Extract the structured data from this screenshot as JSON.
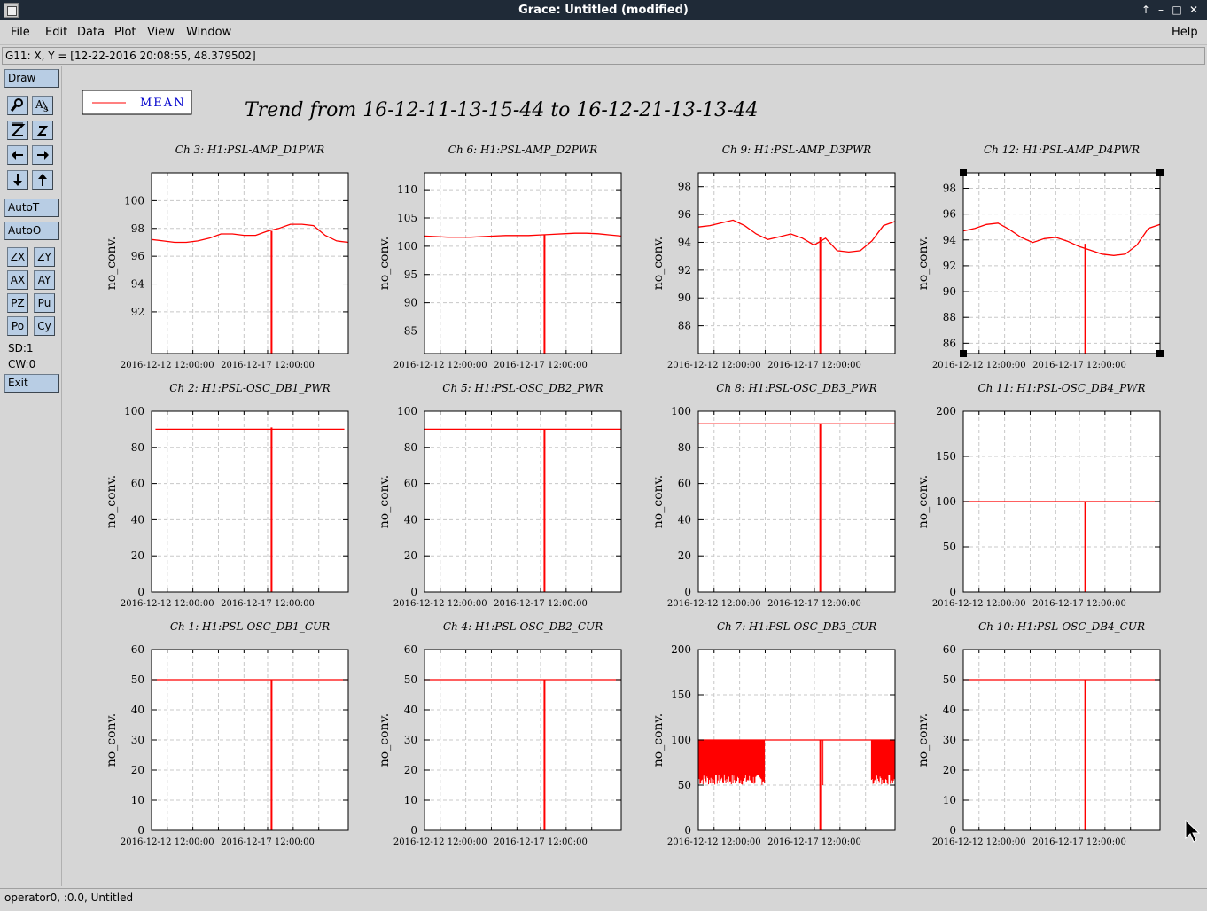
{
  "window": {
    "title": "Grace: Untitled (modified)",
    "buttons": [
      "↑",
      "–",
      "□",
      "✕"
    ]
  },
  "menubar": {
    "items": [
      "File",
      "Edit",
      "Data",
      "Plot",
      "View",
      "Window"
    ],
    "help": "Help"
  },
  "coords_readout": "G11: X, Y = [12-22-2016 20:08:55, 48.379502]",
  "toolbar": {
    "draw": "Draw",
    "autot": "AutoT",
    "autoo": "AutoO",
    "zx": "ZX",
    "zy": "ZY",
    "ax": "AX",
    "ay": "AY",
    "pz": "PZ",
    "pu": "Pu",
    "po": "Po",
    "cy": "Cy",
    "sd": "SD:1",
    "cw": "CW:0",
    "exit": "Exit"
  },
  "status": "operator0, :0.0, Untitled",
  "legend": {
    "label": "MEAN",
    "color": "#ff0000"
  },
  "main_title": "Trend from 16-12-11-13-15-44 to 16-12-21-13-13-44",
  "x_tick_labels": [
    "2016-12-12 12:00:00",
    "2016-12-17 12:00:00"
  ],
  "line_color": "#ff0000",
  "chart_data": [
    {
      "type": "line",
      "title": "Ch 3: H1:PSL-AMP_D1PWR",
      "ylabel": "no_conv.",
      "ylim": [
        89,
        102
      ],
      "yticks": [
        92,
        94,
        96,
        98,
        100
      ],
      "kind": "wave",
      "values": [
        97.2,
        97.1,
        97.0,
        97.0,
        97.1,
        97.3,
        97.6,
        97.6,
        97.5,
        97.5,
        97.8,
        98.0,
        98.3,
        98.3,
        98.2,
        97.5,
        97.1,
        97.0
      ],
      "spike_x": 0.61,
      "spike_top": 97.8
    },
    {
      "type": "line",
      "title": "Ch 6: H1:PSL-AMP_D2PWR",
      "ylabel": "no_conv.",
      "ylim": [
        81,
        113
      ],
      "yticks": [
        85,
        90,
        95,
        100,
        105,
        110
      ],
      "kind": "wave",
      "values": [
        101.8,
        101.7,
        101.6,
        101.6,
        101.6,
        101.7,
        101.8,
        101.9,
        101.9,
        101.9,
        102.0,
        102.1,
        102.2,
        102.3,
        102.3,
        102.2,
        102.0,
        101.8
      ],
      "spike_x": 0.61,
      "spike_top": 102.0
    },
    {
      "type": "line",
      "title": "Ch 9: H1:PSL-AMP_D3PWR",
      "ylabel": "no_conv.",
      "ylim": [
        86,
        99
      ],
      "yticks": [
        88,
        90,
        92,
        94,
        96,
        98
      ],
      "kind": "wave",
      "values": [
        95.1,
        95.2,
        95.4,
        95.6,
        95.2,
        94.6,
        94.2,
        94.4,
        94.6,
        94.3,
        93.8,
        94.3,
        93.4,
        93.3,
        93.4,
        94.1,
        95.2,
        95.5
      ],
      "spike_x": 0.62,
      "spike_top": 94.4
    },
    {
      "type": "line",
      "title": "Ch 12: H1:PSL-AMP_D4PWR",
      "ylabel": "no_conv.",
      "ylim": [
        85.2,
        99.2
      ],
      "yticks": [
        86,
        88,
        90,
        92,
        94,
        96,
        98
      ],
      "kind": "wave",
      "values": [
        94.7,
        94.9,
        95.2,
        95.3,
        94.8,
        94.2,
        93.8,
        94.1,
        94.2,
        93.9,
        93.5,
        93.2,
        92.9,
        92.8,
        92.9,
        93.6,
        94.9,
        95.2
      ],
      "spike_x": 0.62,
      "spike_top": 93.7
    },
    {
      "type": "line",
      "title": "Ch 2: H1:PSL-OSC_DB1_PWR",
      "ylabel": "no_conv.",
      "ylim": [
        0,
        100
      ],
      "yticks": [
        0,
        20,
        40,
        60,
        80,
        100
      ],
      "kind": "flat",
      "level": 90,
      "x_start": 0.02,
      "x_end": 0.98,
      "spike_x": 0.61,
      "spike_top": 91
    },
    {
      "type": "line",
      "title": "Ch 5: H1:PSL-OSC_DB2_PWR",
      "ylabel": "no_conv.",
      "ylim": [
        0,
        100
      ],
      "yticks": [
        0,
        20,
        40,
        60,
        80,
        100
      ],
      "kind": "flat",
      "level": 90,
      "x_start": 0.0,
      "x_end": 1.0,
      "spike_x": 0.61,
      "spike_top": 90
    },
    {
      "type": "line",
      "title": "Ch 8: H1:PSL-OSC_DB3_PWR",
      "ylabel": "no_conv.",
      "ylim": [
        0,
        100
      ],
      "yticks": [
        0,
        20,
        40,
        60,
        80,
        100
      ],
      "kind": "flat",
      "level": 93,
      "x_start": 0.0,
      "x_end": 1.0,
      "spike_x": 0.62,
      "spike_top": 93
    },
    {
      "type": "line",
      "title": "Ch 11: H1:PSL-OSC_DB4_PWR",
      "ylabel": "no_conv.",
      "ylim": [
        0,
        200
      ],
      "yticks": [
        0,
        50,
        100,
        150,
        200
      ],
      "kind": "flat",
      "level": 100,
      "x_start": 0.0,
      "x_end": 1.0,
      "spike_x": 0.62,
      "spike_top": 100
    },
    {
      "type": "line",
      "title": "Ch 1: H1:PSL-OSC_DB1_CUR",
      "ylabel": "no_conv.",
      "ylim": [
        0,
        60
      ],
      "yticks": [
        0,
        10,
        20,
        30,
        40,
        50,
        60
      ],
      "kind": "flat",
      "level": 50,
      "x_start": 0.0,
      "x_end": 1.0,
      "spike_x": 0.61,
      "spike_top": 50
    },
    {
      "type": "line",
      "title": "Ch 4: H1:PSL-OSC_DB2_CUR",
      "ylabel": "no_conv.",
      "ylim": [
        0,
        60
      ],
      "yticks": [
        0,
        10,
        20,
        30,
        40,
        50,
        60
      ],
      "kind": "flat",
      "level": 50,
      "x_start": 0.0,
      "x_end": 1.0,
      "spike_x": 0.61,
      "spike_top": 50
    },
    {
      "type": "line",
      "title": "Ch 7: H1:PSL-OSC_DB3_CUR",
      "ylabel": "no_conv.",
      "ylim": [
        0,
        200
      ],
      "yticks": [
        0,
        50,
        100,
        150,
        200
      ],
      "kind": "noisy",
      "level": 100,
      "low": 50,
      "noisy_ranges": [
        [
          0.0,
          0.34
        ],
        [
          0.88,
          1.0
        ]
      ],
      "spike_x": 0.62,
      "spike_top": 100
    },
    {
      "type": "line",
      "title": "Ch 10: H1:PSL-OSC_DB4_CUR",
      "ylabel": "no_conv.",
      "ylim": [
        0,
        60
      ],
      "yticks": [
        0,
        10,
        20,
        30,
        40,
        50,
        60
      ],
      "kind": "flat",
      "level": 50,
      "x_start": 0.0,
      "x_end": 1.0,
      "spike_x": 0.62,
      "spike_top": 50
    }
  ]
}
